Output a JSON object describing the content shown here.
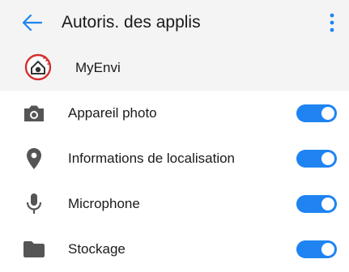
{
  "header": {
    "title": "Autoris. des applis",
    "back_icon": "arrow-left-icon",
    "menu_icon": "more-vert-icon"
  },
  "app": {
    "name": "MyEnvi",
    "icon": "myenvi-logo-icon"
  },
  "permissions": [
    {
      "label": "Appareil photo",
      "icon": "camera-icon",
      "enabled": true
    },
    {
      "label": "Informations de localisation",
      "icon": "location-pin-icon",
      "enabled": true
    },
    {
      "label": "Microphone",
      "icon": "microphone-icon",
      "enabled": true
    },
    {
      "label": "Stockage",
      "icon": "folder-icon",
      "enabled": true
    }
  ],
  "colors": {
    "accent": "#1f84f2",
    "header_bg": "#f4f4f4",
    "icon_gray": "#555555",
    "logo_red": "#d32f2f"
  }
}
